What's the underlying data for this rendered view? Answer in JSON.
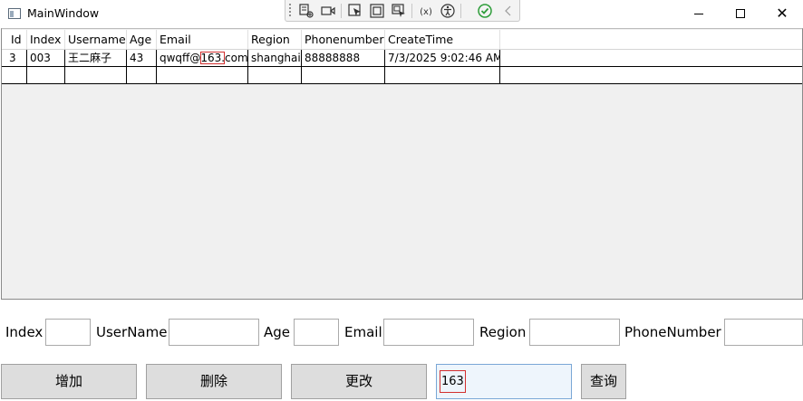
{
  "window": {
    "title": "MainWindow"
  },
  "window_controls": {
    "minimize": "—",
    "maximize": "☐",
    "close": "✕"
  },
  "debug_toolbar": {
    "tools": [
      "live-visual-tree-icon",
      "record-icon",
      "select-element-icon",
      "display-layout-adorners-icon",
      "track-focus-icon",
      "binding-failures-icon",
      "accessibility-icon",
      "checkmark-icon",
      "collapse-icon"
    ]
  },
  "grid": {
    "columns": [
      "Id",
      "Index",
      "Username",
      "Age",
      "Email",
      "Region",
      "Phonenumber",
      "CreateTime"
    ],
    "rows": [
      [
        "3",
        "003",
        "王二麻子",
        "43",
        "qwqff@163.com",
        "shanghai",
        "88888888",
        "7/3/2025 9:02:46 AM"
      ]
    ],
    "highlight": {
      "email_prefix": "qwqff@",
      "email_match": "163.",
      "email_suffix": "com"
    }
  },
  "form": {
    "index_label": "Index",
    "username_label": "UserName",
    "age_label": "Age",
    "email_label": "Email",
    "region_label": "Region",
    "phone_label": "PhoneNumber",
    "index_value": "",
    "username_value": "",
    "age_value": "",
    "email_value": "",
    "region_value": "",
    "phone_value": ""
  },
  "buttons": {
    "add": "增加",
    "delete": "删除",
    "update": "更改",
    "query": "查询"
  },
  "query": {
    "value": "163"
  },
  "colors": {
    "highlight": "#d32f2f",
    "grid_bg": "#f0f0f0",
    "button_bg": "#dddddd"
  }
}
